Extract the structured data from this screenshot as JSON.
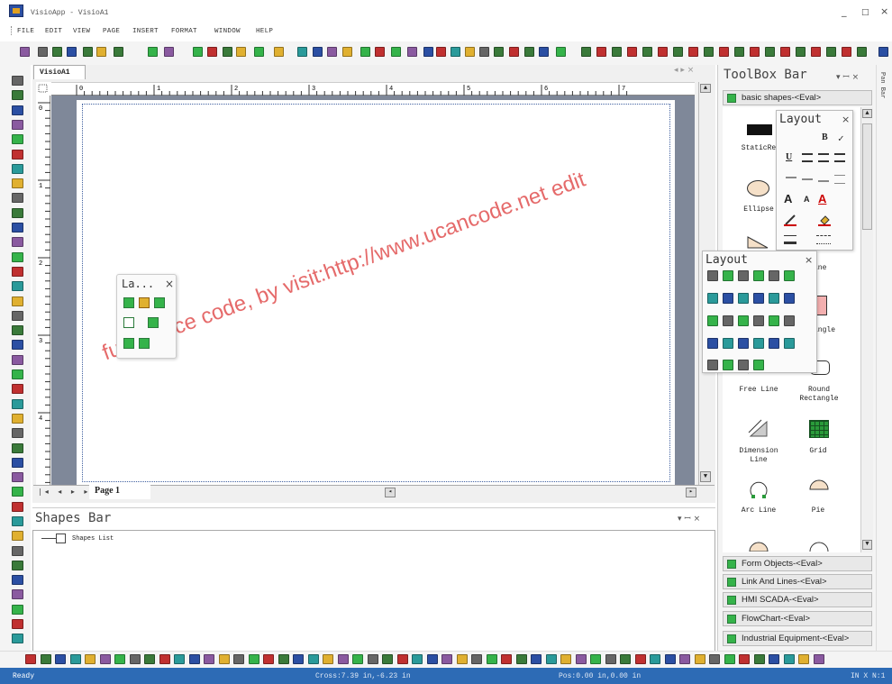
{
  "window": {
    "title": "VisioApp - VisioA1",
    "min_label": "_",
    "max_label": "□",
    "close_label": "×"
  },
  "menu": [
    "FILE",
    "EDIT",
    "VIEW",
    "PAGE",
    "INSERT",
    "FORMAT",
    "WINDOW",
    "HELP"
  ],
  "document": {
    "tab": "VisioA1",
    "page_tab": "Page  1",
    "ruler_numbers": [
      "0",
      "1",
      "2",
      "3",
      "4",
      "5",
      "6",
      "7"
    ],
    "vruler_numbers": [
      "0",
      "1",
      "2",
      "3",
      "4"
    ]
  },
  "watermark": "full source code, by visit:http://www.ucancode.net edit",
  "small_palette": {
    "title": "La...",
    "close": "×"
  },
  "shapes_bar": {
    "title": "Shapes Bar",
    "controls": "▾ ꟷ ×",
    "tree_item": "Shapes List"
  },
  "toolbox": {
    "title": "ToolBox Bar",
    "controls": "▾ ꟷ ×",
    "top_category": "basic shapes-<Eval>",
    "categories": [
      "Form Objects-<Eval>",
      "Link And Lines-<Eval>",
      "HMI SCADA-<Eval>",
      "FlowChart-<Eval>",
      "Industrial Equipment-<Eval>"
    ],
    "shapes": [
      {
        "label": "StaticRe"
      },
      {
        "label": "Ellipse"
      },
      {
        "label": "Free Line"
      },
      {
        "label": "Round Rectangle"
      },
      {
        "label": "Dimension Line"
      },
      {
        "label": "Grid"
      },
      {
        "label": "Arc Line"
      },
      {
        "label": "Pie"
      }
    ],
    "partial_labels": [
      "ine",
      "angle"
    ]
  },
  "layout_palette_1": {
    "title": "Layout",
    "close": "×"
  },
  "layout_palette_2": {
    "title": "Layout",
    "close": "×"
  },
  "right_strip": "Pan Bar",
  "status": {
    "ready": "Ready",
    "cross": "Cross:7.39 in,-6.23 in",
    "pos": "Pos:0.00 in,0.00 in",
    "right": "IN X N:1"
  },
  "colors": {
    "status_bg": "#2d6bb5",
    "canvas_bg": "#7f8899",
    "green_icon": "#35b34a"
  }
}
